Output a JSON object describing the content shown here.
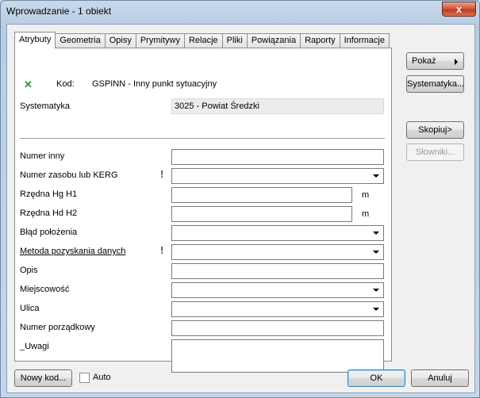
{
  "window": {
    "title": "Wprowadzanie - 1 obiekt",
    "close_glyph": "x"
  },
  "tabs": [
    {
      "label": "Atrybuty",
      "active": true
    },
    {
      "label": "Geometria"
    },
    {
      "label": "Opisy"
    },
    {
      "label": "Prymitywy"
    },
    {
      "label": "Relacje"
    },
    {
      "label": "Pliki"
    },
    {
      "label": "Powiązania"
    },
    {
      "label": "Raporty"
    },
    {
      "label": "Informacje"
    }
  ],
  "header": {
    "kod_label": "Kod:",
    "kod_value": "GSPINN - Inny punkt sytuacyjny",
    "systematyka_label": "Systematyka",
    "systematyka_value": "3025 - Powiat Średzki",
    "status_icon": "green-check-icon"
  },
  "fields": [
    {
      "label": "Numer inny",
      "value": ""
    },
    {
      "label": "Numer zasobu lub KERG",
      "value": "",
      "required_mark": "!"
    },
    {
      "label": "Rzędna Hg H1",
      "value": "",
      "unit": "m"
    },
    {
      "label": "Rzędna Hd H2",
      "value": "",
      "unit": "m"
    },
    {
      "label": "Błąd położenia",
      "value": ""
    },
    {
      "label": "Metoda pozyskania danych",
      "value": "",
      "required_mark": "!"
    },
    {
      "label": "Opis",
      "value": ""
    },
    {
      "label": "Miejscowość",
      "value": ""
    },
    {
      "label": "Ulica",
      "value": ""
    },
    {
      "label": "Numer porządkowy",
      "value": ""
    },
    {
      "label": "_Uwagi",
      "value": ""
    }
  ],
  "side_buttons": {
    "pokaz": "Pokaż",
    "systematyka": "Systematyka...",
    "skopiuj": "Skopiuj>",
    "slowniki": "Słowniki..."
  },
  "footer": {
    "nowy_kod": "Nowy kod...",
    "auto_label": "Auto",
    "ok": "OK",
    "anuluj": "Anuluj"
  }
}
